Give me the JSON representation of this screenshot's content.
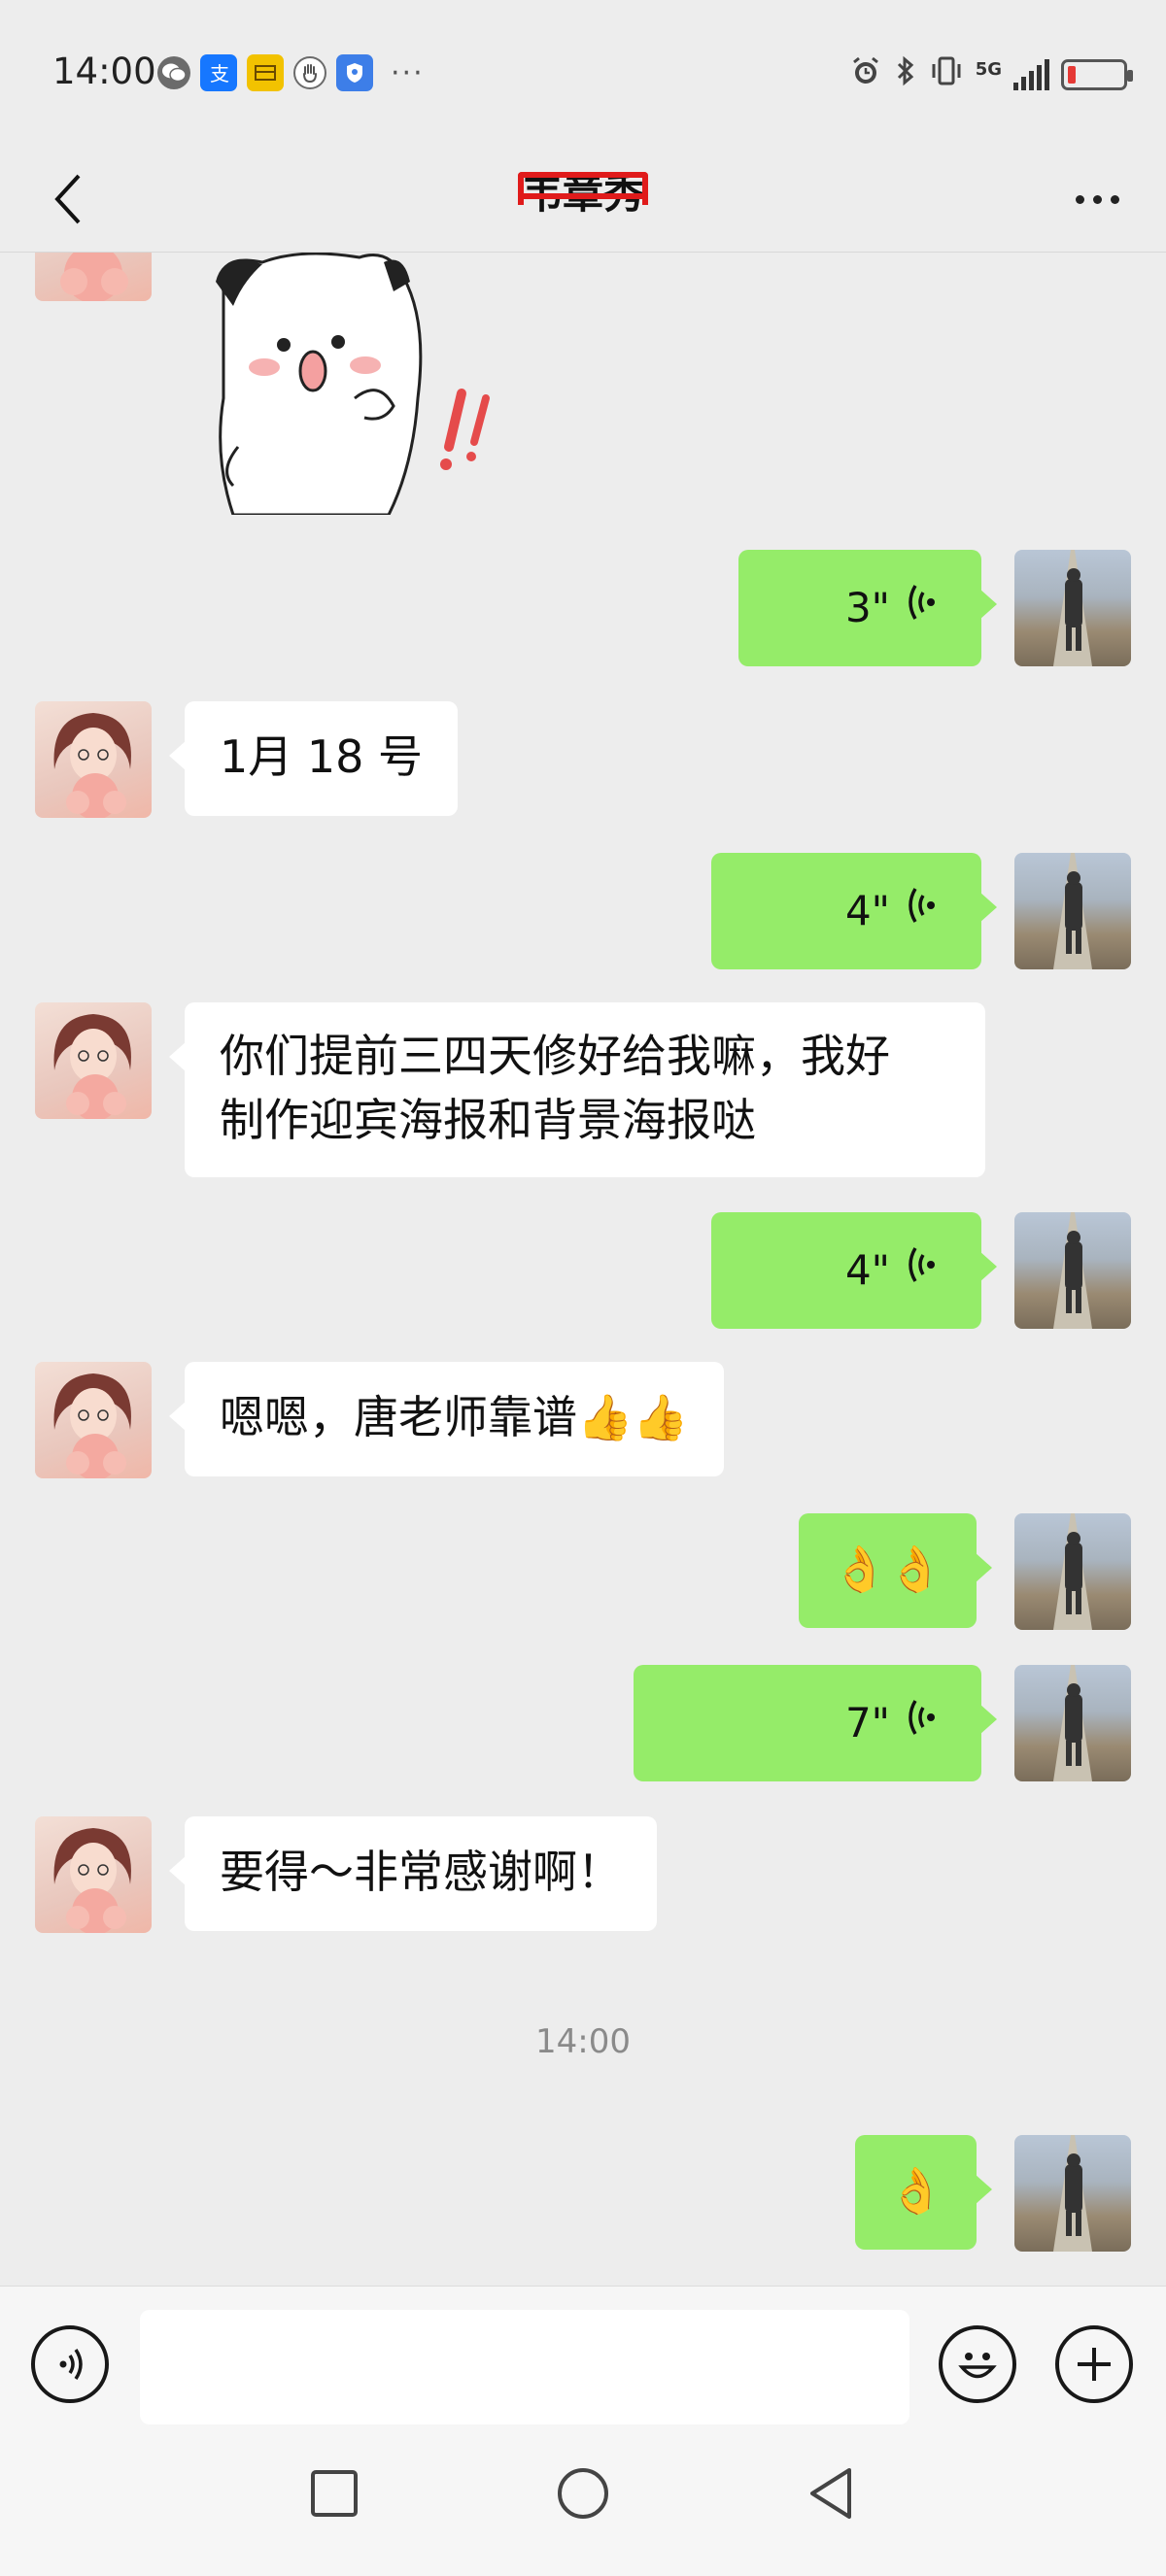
{
  "status_bar": {
    "time": "14:00",
    "more": "···",
    "network": "5G"
  },
  "header": {
    "contact_name": "韦章秀",
    "more_icon": "more-dots-icon",
    "back_icon": "back-arrow-icon"
  },
  "messages": [
    {
      "side": "in",
      "type": "sticker",
      "sticker": "surprised-cat-sticker"
    },
    {
      "side": "out",
      "type": "voice",
      "duration": "3\""
    },
    {
      "side": "in",
      "type": "text",
      "text": "1月 18 号"
    },
    {
      "side": "out",
      "type": "voice",
      "duration": "4\""
    },
    {
      "side": "in",
      "type": "text",
      "text_line1": "你们提前三四天修好给我嘛，我好",
      "text_line2": "制作迎宾海报和背景海报哒"
    },
    {
      "side": "out",
      "type": "voice",
      "duration": "4\""
    },
    {
      "side": "in",
      "type": "text",
      "text": "嗯嗯，唐老师靠谱👍👍"
    },
    {
      "side": "out",
      "type": "emoji",
      "text": "👌👌"
    },
    {
      "side": "out",
      "type": "voice",
      "duration": "7\""
    },
    {
      "side": "in",
      "type": "text",
      "text": "要得～非常感谢啊！"
    },
    {
      "side": "out",
      "type": "emoji",
      "text": "👌"
    }
  ],
  "timestamp": "14:00",
  "input_bar": {
    "voice_icon": "voice-input-icon",
    "emoji_icon": "emoji-icon",
    "plus_icon": "plus-icon",
    "text_value": ""
  },
  "system_nav": [
    "recent-apps-icon",
    "home-icon",
    "back-icon"
  ],
  "colors": {
    "background": "#ededed",
    "outgoing_bubble": "#95ec69",
    "incoming_bubble": "#ffffff",
    "redaction": "#e01b1b"
  }
}
